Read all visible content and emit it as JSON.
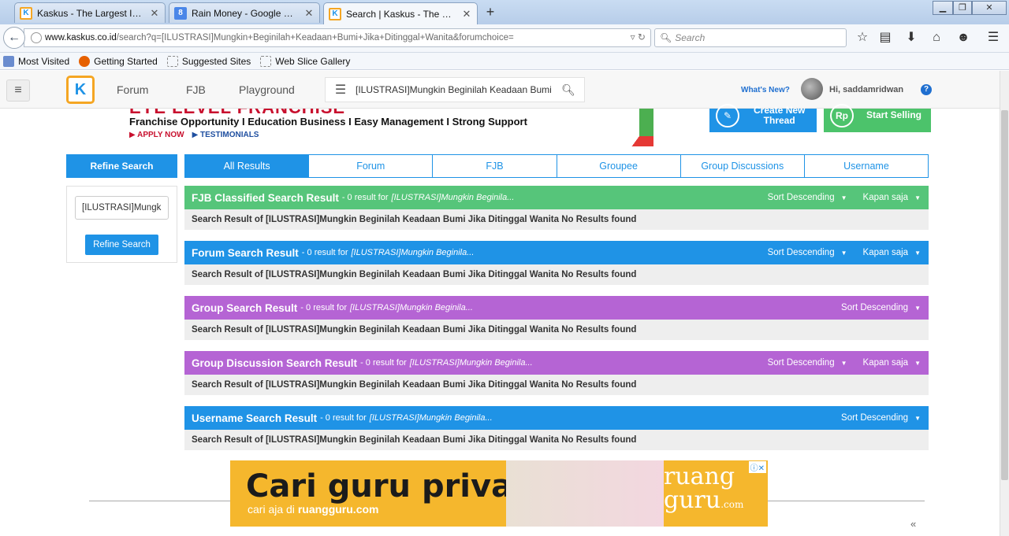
{
  "browser": {
    "tabs": [
      {
        "title": "Kaskus - The Largest Indon...",
        "favicon": "kaskus-icon",
        "active": false
      },
      {
        "title": "Rain Money - Google Search",
        "favicon": "google-icon",
        "active": false
      },
      {
        "title": "Search | Kaskus - The Large...",
        "favicon": "kaskus-icon",
        "active": true
      }
    ],
    "url_domain": "www.kaskus.co.id",
    "url_path": "/search?q=[ILUSTRASI]Mungkin+Beginilah+Keadaan+Bumi+Jika+Ditinggal+Wanita&forumchoice=",
    "search_placeholder": "Search",
    "bookmarks": [
      "Most Visited",
      "Getting Started",
      "Suggested Sites",
      "Web Slice Gallery"
    ]
  },
  "site": {
    "nav": [
      "Forum",
      "FJB",
      "Playground"
    ],
    "search_value": "[ILUSTRASI]Mungkin Beginilah Keadaan Bumi",
    "whats_new": "What's New?",
    "greeting": "Hi, saddamridwan"
  },
  "banner": {
    "big": "EYE LEVEL FRANCHISE",
    "line1": "Franchise Opportunity I Education Business I Easy Management I Strong Support",
    "apply": "▶ APPLY NOW",
    "testimonials": "▶ TESTIMONIALS"
  },
  "actions": {
    "create_line1": "Create New",
    "create_line2": "Thread",
    "create_icon": "Rp",
    "sell": "Start Selling"
  },
  "refine": {
    "header": "Refine Search",
    "input_value": "[ILUSTRASI]Mungkin Beginilah Keadaan Bumi Jika Ditinggal Wanita",
    "button": "Refine Search"
  },
  "result_tabs": [
    "All Results",
    "Forum",
    "FJB",
    "Groupee",
    "Group Discussions",
    "Username"
  ],
  "sections": [
    {
      "title": "FJB Classified Search Result",
      "count": "- 0 result for",
      "query": "[ILUSTRASI]Mungkin Beginila...",
      "sort": "Sort Descending",
      "time": "Kapan saja",
      "body": "Search Result of [ILUSTRASI]Mungkin Beginilah Keadaan Bumi Jika Ditinggal Wanita No Results found"
    },
    {
      "title": "Forum Search Result",
      "count": "- 0 result for",
      "query": "[ILUSTRASI]Mungkin Beginila...",
      "sort": "Sort Descending",
      "time": "Kapan saja",
      "body": "Search Result of [ILUSTRASI]Mungkin Beginilah Keadaan Bumi Jika Ditinggal Wanita No Results found"
    },
    {
      "title": "Group Search Result",
      "count": "- 0 result for",
      "query": "[ILUSTRASI]Mungkin Beginila...",
      "sort": "Sort Descending",
      "body": "Search Result of [ILUSTRASI]Mungkin Beginilah Keadaan Bumi Jika Ditinggal Wanita No Results found"
    },
    {
      "title": "Group Discussion Search Result",
      "count": "- 0 result for",
      "query": "[ILUSTRASI]Mungkin Beginila...",
      "sort": "Sort Descending",
      "time": "Kapan saja",
      "body": "Search Result of [ILUSTRASI]Mungkin Beginilah Keadaan Bumi Jika Ditinggal Wanita No Results found"
    },
    {
      "title": "Username Search Result",
      "count": "- 0 result for",
      "query": "[ILUSTRASI]Mungkin Beginila...",
      "sort": "Sort Descending",
      "body": "Search Result of [ILUSTRASI]Mungkin Beginilah Keadaan Bumi Jika Ditinggal Wanita No Results found"
    }
  ],
  "ad": {
    "headline": "Cari guru privat?",
    "sub_prefix": "cari aja di",
    "sub_brand": "ruangguru.com",
    "brand_top": "ruang",
    "brand_bottom": "guru",
    "brand_suffix": ".com"
  },
  "colors": {
    "kaskus_blue": "#1f93e6",
    "green": "#56c57a",
    "purple": "#b564d4",
    "ad_yellow": "#f5b72d"
  }
}
